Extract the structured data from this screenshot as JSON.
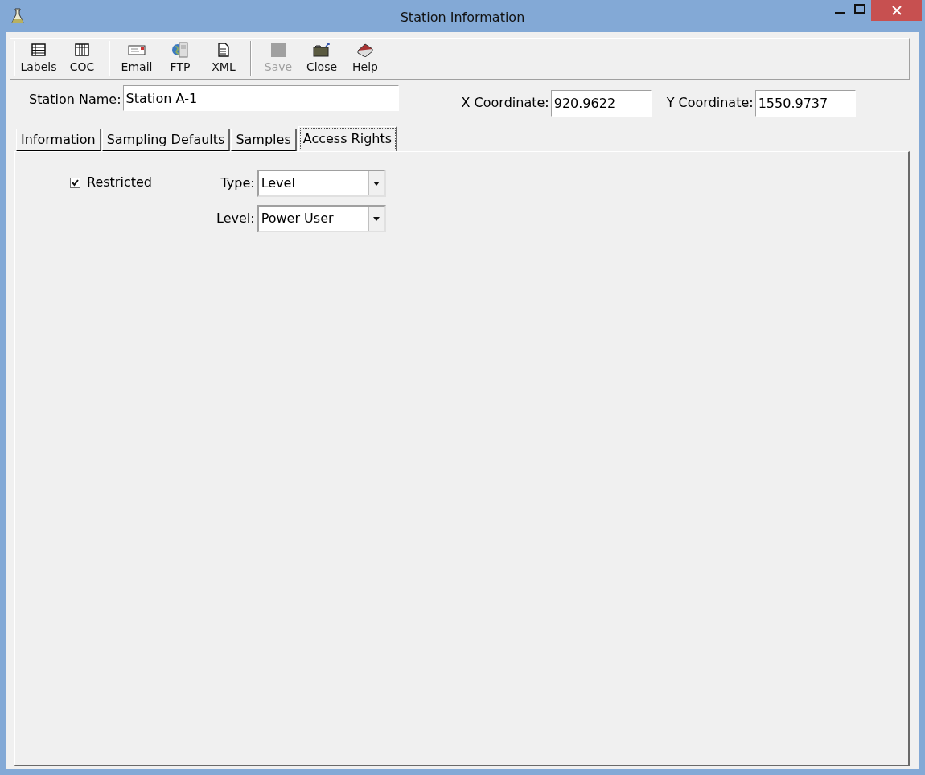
{
  "window": {
    "title": "Station Information"
  },
  "toolbar": [
    {
      "label": "Labels",
      "kind": "labels",
      "disabled": false
    },
    {
      "label": "COC",
      "kind": "coc",
      "disabled": false
    },
    {
      "kind": "separator"
    },
    {
      "label": "Email",
      "kind": "email",
      "disabled": false
    },
    {
      "label": "FTP",
      "kind": "ftp",
      "disabled": false
    },
    {
      "label": "XML",
      "kind": "xml",
      "disabled": false
    },
    {
      "kind": "separator"
    },
    {
      "label": "Save",
      "kind": "save",
      "disabled": true
    },
    {
      "label": "Close",
      "kind": "close",
      "disabled": false
    },
    {
      "label": "Help",
      "kind": "help",
      "disabled": false
    }
  ],
  "station_name": {
    "label": "Station Name:",
    "value": "Station A-1"
  },
  "x_coordinate": {
    "label": "X Coordinate:",
    "value": "920.9622"
  },
  "y_coordinate": {
    "label": "Y Coordinate:",
    "value": "1550.9737"
  },
  "tabs": [
    {
      "label": "Information",
      "selected": false
    },
    {
      "label": "Sampling Defaults",
      "selected": false
    },
    {
      "label": "Samples",
      "selected": false
    },
    {
      "label": "Access Rights",
      "selected": true
    }
  ],
  "access_rights": {
    "restricted": {
      "label": "Restricted",
      "checked": true
    },
    "type": {
      "label": "Type:",
      "value": "Level"
    },
    "level": {
      "label": "Level:",
      "value": "Power User"
    }
  }
}
